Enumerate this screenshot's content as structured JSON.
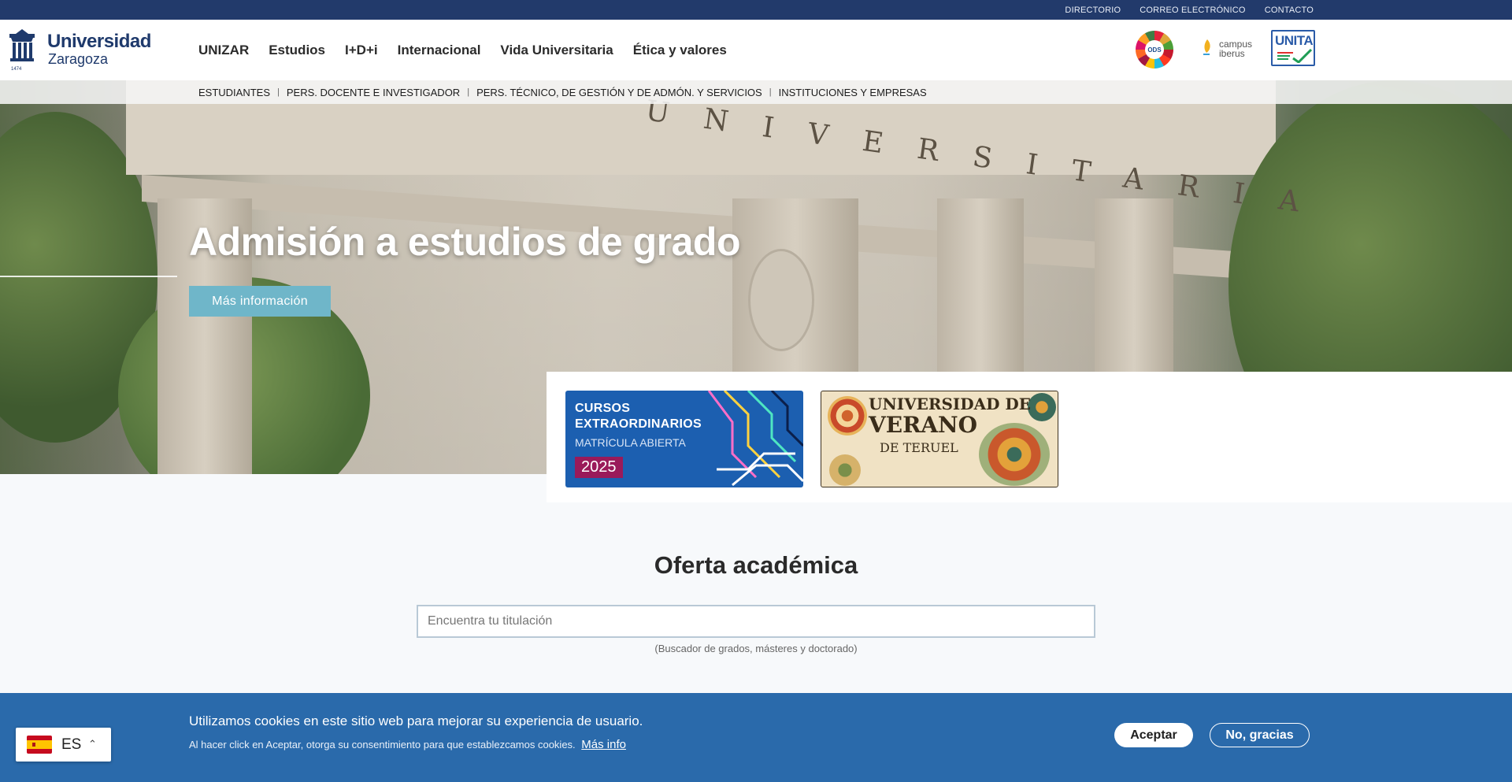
{
  "topbar": {
    "links": [
      "DIRECTORIO",
      "CORREO ELECTRÓNICO",
      "CONTACTO"
    ]
  },
  "header": {
    "logo_line1": "Universidad",
    "logo_line2": "Zaragoza",
    "logo_year": "1474",
    "nav": [
      "UNIZAR",
      "Estudios",
      "I+D+i",
      "Internacional",
      "Vida Universitaria",
      "Ética y valores"
    ],
    "partners": {
      "ods": "ODS",
      "campus_line1": "campus",
      "campus_line2": "iberus",
      "unita": "UNITA"
    }
  },
  "subnav": [
    "ESTUDIANTES",
    "PERS. DOCENTE E INVESTIGADOR",
    "PERS. TÉCNICO, DE GESTIÓN Y DE ADMÓN. Y SERVICIOS",
    "INSTITUCIONES Y EMPRESAS"
  ],
  "hero": {
    "carved_text": "UNIVERSITARIA",
    "title": "Admisión a estudios de grado",
    "button": "Más información"
  },
  "promos": {
    "card1": {
      "line1": "CURSOS",
      "line2": "EXTRAORDINARIOS",
      "line3": "MATRÍCULA ABIERTA",
      "year": "2025"
    },
    "card2": {
      "line1": "UNIVERSIDAD DE",
      "line2": "VERANO",
      "line3": "DE TERUEL"
    }
  },
  "oferta": {
    "title": "Oferta académica",
    "search_placeholder": "Encuentra tu titulación",
    "hint": "(Buscador de grados, másteres y doctorado)"
  },
  "cookie": {
    "message": "Utilizamos cookies en este sitio web para mejorar su experiencia de usuario.",
    "sub": "Al hacer click en Aceptar, otorga su consentimiento para que establezcamos cookies.",
    "more": "Más info",
    "accept": "Aceptar",
    "decline": "No, gracias"
  },
  "language": {
    "code": "ES"
  },
  "colors": {
    "topbar": "#223a6b",
    "brand": "#1f3a6c",
    "hero_button": "#6fb6c9",
    "cookie_bg": "#2a6aab"
  },
  "icons": [
    "university-crest-icon",
    "ods-wheel-icon",
    "campus-iberus-leaf-icon",
    "unita-check-icon",
    "spain-flag-icon",
    "chevron-up-icon"
  ]
}
